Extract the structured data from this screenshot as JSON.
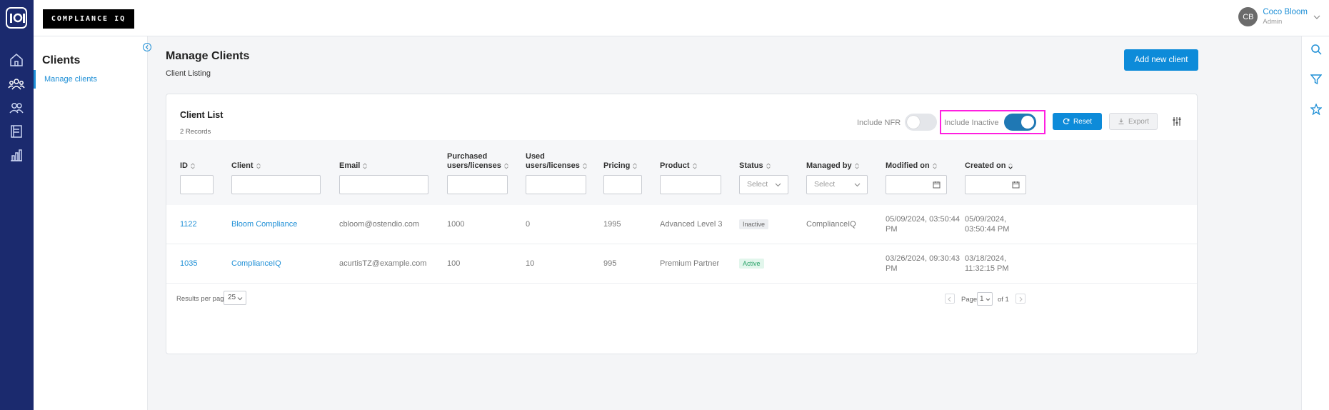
{
  "brand": {
    "logo_text": "COMPLIANCE IQ"
  },
  "user": {
    "initials": "CB",
    "name": "Coco Bloom",
    "role": "Admin"
  },
  "subnav": {
    "title": "Clients",
    "items": [
      {
        "label": "Manage clients"
      }
    ]
  },
  "page": {
    "title": "Manage Clients",
    "subtitle": "Client Listing",
    "add_button": "Add new client"
  },
  "card": {
    "title": "Client List",
    "record_count": "2 Records",
    "include_nfr": {
      "label": "Include NFR",
      "on": false
    },
    "include_inactive": {
      "label": "Include Inactive",
      "on": true
    },
    "reset_label": "Reset",
    "export_label": "Export"
  },
  "table": {
    "columns": {
      "id": "ID",
      "client": "Client",
      "email": "Email",
      "purchased_1": "Purchased",
      "purchased_2": "users/licenses",
      "used_1": "Used",
      "used_2": "users/licenses",
      "pricing": "Pricing",
      "product": "Product",
      "status": "Status",
      "managed_by": "Managed by",
      "modified_on": "Modified on",
      "created_on": "Created on"
    },
    "filters": {
      "status_placeholder": "Select",
      "managed_placeholder": "Select"
    },
    "rows": [
      {
        "id": "1122",
        "client": "Bloom Compliance",
        "email": "cbloom@ostendio.com",
        "purchased": "1000",
        "used": "0",
        "pricing": "1995",
        "product": "Advanced Level 3",
        "status": "Inactive",
        "managed_by": "ComplianceIQ",
        "modified_1": "05/09/2024, 03:50:44",
        "modified_2": "PM",
        "created_1": "05/09/2024,",
        "created_2": "03:50:44 PM"
      },
      {
        "id": "1035",
        "client": "ComplianceIQ",
        "email": "acurtisTZ@example.com",
        "purchased": "100",
        "used": "10",
        "pricing": "995",
        "product": "Premium Partner",
        "status": "Active",
        "managed_by": "",
        "modified_1": "03/26/2024, 09:30:43",
        "modified_2": "PM",
        "created_1": "03/18/2024,",
        "created_2": "11:32:15 PM"
      }
    ]
  },
  "pagination": {
    "results_per_page_label": "Results per page",
    "results_per_page": "25",
    "page_label": "Page",
    "current_page": "1",
    "of_label": "of 1"
  },
  "colors": {
    "rail": "#1b2a6e",
    "primary": "#0d8bd9",
    "highlight": "#ff1fe0",
    "toggle_on": "#1f78b4"
  }
}
